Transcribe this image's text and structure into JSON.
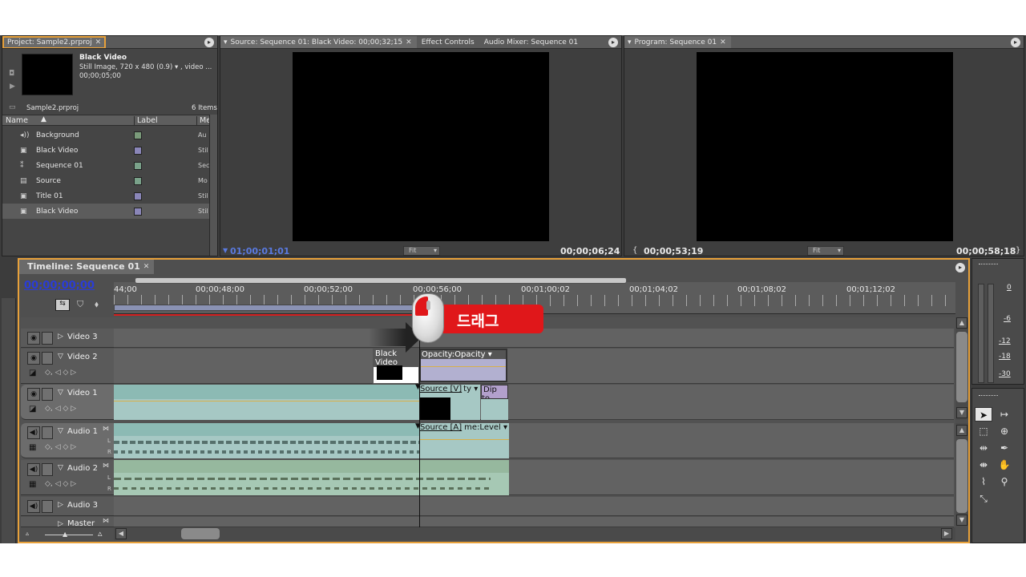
{
  "project": {
    "tab_title": "Project: Sample2.prproj",
    "clip_name": "Black Video",
    "clip_info": "Still Image, 720 x 480 (0.9)  ▾ , video ...",
    "clip_duration": "00;00;05;00",
    "bin_name": "Sample2.prproj",
    "item_count": "6 Items",
    "columns": {
      "name": "Name",
      "label": "Label",
      "media": "Me"
    },
    "items": [
      {
        "name": "Background",
        "icon": "audio-icon",
        "color": "#7a9a7a",
        "type": "Au"
      },
      {
        "name": "Black Video",
        "icon": "still-image-icon",
        "color": "#8a86b8",
        "type": "Stil"
      },
      {
        "name": "Sequence 01",
        "icon": "sequence-icon",
        "color": "#7aa28a",
        "type": "Sec"
      },
      {
        "name": "Source",
        "icon": "movie-icon",
        "color": "#7aa28a",
        "type": "Mo"
      },
      {
        "name": "Title 01",
        "icon": "title-icon",
        "color": "#8a86b8",
        "type": "Stil"
      },
      {
        "name": "Black Video",
        "icon": "still-image-icon",
        "color": "#8a86b8",
        "type": "Stil"
      }
    ]
  },
  "source": {
    "tabs": [
      "Source: Sequence 01: Black Video: 00;00;32;15",
      "Effect Controls",
      "Audio Mixer: Sequence 01"
    ],
    "timecode_in": "01;00;01;01",
    "fit": "Fit",
    "timecode_out": "00;00;06;24"
  },
  "program": {
    "tab": "Program: Sequence 01",
    "timecode_in": "00;00;53;19",
    "fit": "Fit",
    "timecode_out": "00;00;58;18"
  },
  "timeline": {
    "tab": "Timeline: Sequence 01",
    "current_time": "00;00;00;00",
    "ruler": [
      "44;00",
      "00;00;48;00",
      "00;00;52;00",
      "00;00;56;00",
      "00;01;00;02",
      "00;01;04;02",
      "00;01;08;02",
      "00;01;12;02"
    ],
    "tracks": {
      "video3": "Video 3",
      "video2": "Video 2",
      "video1": "Video 1",
      "audio1": "Audio 1",
      "audio2": "Audio 2",
      "audio3": "Audio 3",
      "master": "Master"
    },
    "clips": {
      "v2_black": "Black Video",
      "v2_opacity": "Opacity:Opacity ▾",
      "v1_source": "Source [V]",
      "v1_fx": "ty ▾",
      "v1_dip": "Dip to",
      "a1_source": "Source [A]",
      "a1_level": "me:Level ▾"
    },
    "drag_callout": "드래그"
  },
  "audio_meter": {
    "levels": [
      "0",
      "-6",
      "-12",
      "-18",
      "-30"
    ]
  },
  "colors": {
    "accent": "#e8a13a",
    "timecode_blue": "#2a3cd8",
    "callout_red": "#e0171a",
    "video_clip": "#a6c8c4",
    "opacity_clip": "#b2b0d0",
    "audio_clip": "#a6c8c4"
  }
}
